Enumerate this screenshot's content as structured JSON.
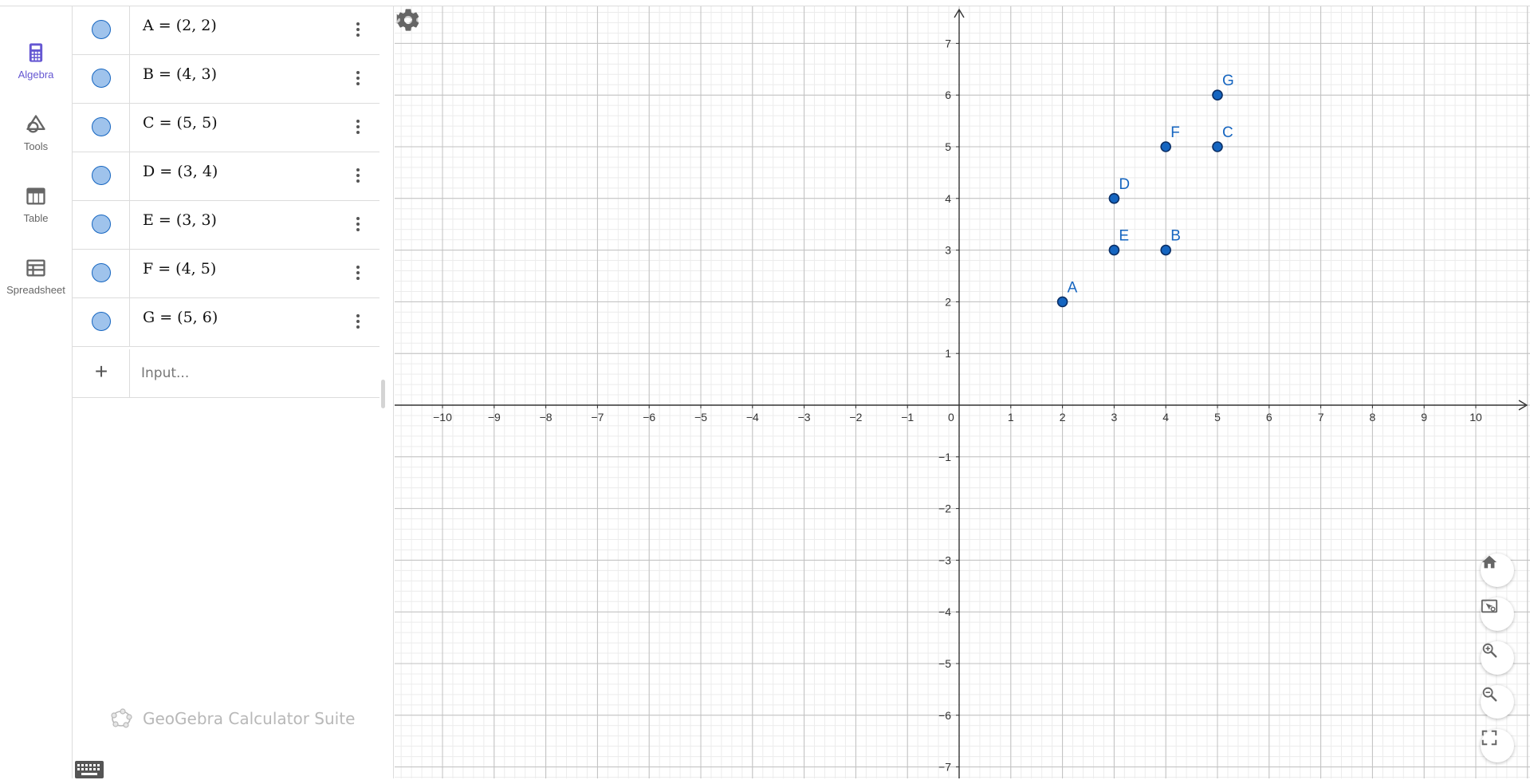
{
  "nav": {
    "items": [
      {
        "label": "Algebra",
        "icon": "calculator-icon",
        "active": true
      },
      {
        "label": "Tools",
        "icon": "shapes-icon",
        "active": false
      },
      {
        "label": "Table",
        "icon": "table-icon",
        "active": false
      },
      {
        "label": "Spreadsheet",
        "icon": "spreadsheet-icon",
        "active": false
      }
    ]
  },
  "algebra": {
    "rows": [
      {
        "name": "A",
        "text": "A = (2, 2)"
      },
      {
        "name": "B",
        "text": "B = (4, 3)"
      },
      {
        "name": "C",
        "text": "C = (5, 5)"
      },
      {
        "name": "D",
        "text": "D = (3, 4)"
      },
      {
        "name": "E",
        "text": "E = (3, 3)"
      },
      {
        "name": "F",
        "text": "F = (4, 5)"
      },
      {
        "name": "G",
        "text": "G = (5, 6)"
      }
    ],
    "input_placeholder": "Input...",
    "marble_color": "#9fc3ec",
    "brand": "GeoGebra Calculator Suite"
  },
  "graphics": {
    "x_ticks": [
      "−10",
      "−9",
      "−8",
      "−7",
      "−6",
      "−5",
      "−4",
      "−3",
      "−2",
      "−1",
      "0",
      "1",
      "2",
      "3",
      "4",
      "5",
      "6",
      "7",
      "8",
      "9",
      "10"
    ],
    "y_ticks": [
      "7",
      "6",
      "5",
      "4",
      "3",
      "2",
      "1",
      "−1",
      "−2",
      "−3",
      "−4",
      "−5",
      "−6",
      "−7"
    ],
    "x_range": [
      -11,
      11
    ],
    "y_range": [
      -7,
      7
    ],
    "point_color": "#1565c0",
    "label_color": "#1565c0",
    "points": [
      {
        "label": "A",
        "x": 2,
        "y": 2
      },
      {
        "label": "B",
        "x": 4,
        "y": 3
      },
      {
        "label": "C",
        "x": 5,
        "y": 5
      },
      {
        "label": "D",
        "x": 3,
        "y": 4
      },
      {
        "label": "E",
        "x": 3,
        "y": 3
      },
      {
        "label": "F",
        "x": 4,
        "y": 5
      },
      {
        "label": "G",
        "x": 5,
        "y": 6
      }
    ],
    "buttons": {
      "undo": "undo-icon",
      "redo": "redo-icon",
      "settings": "gear-icon",
      "home": "home-icon",
      "view": "view-objects-icon",
      "zoom_in": "zoom-in-icon",
      "zoom_out": "zoom-out-icon",
      "fullscreen": "fullscreen-icon"
    }
  }
}
